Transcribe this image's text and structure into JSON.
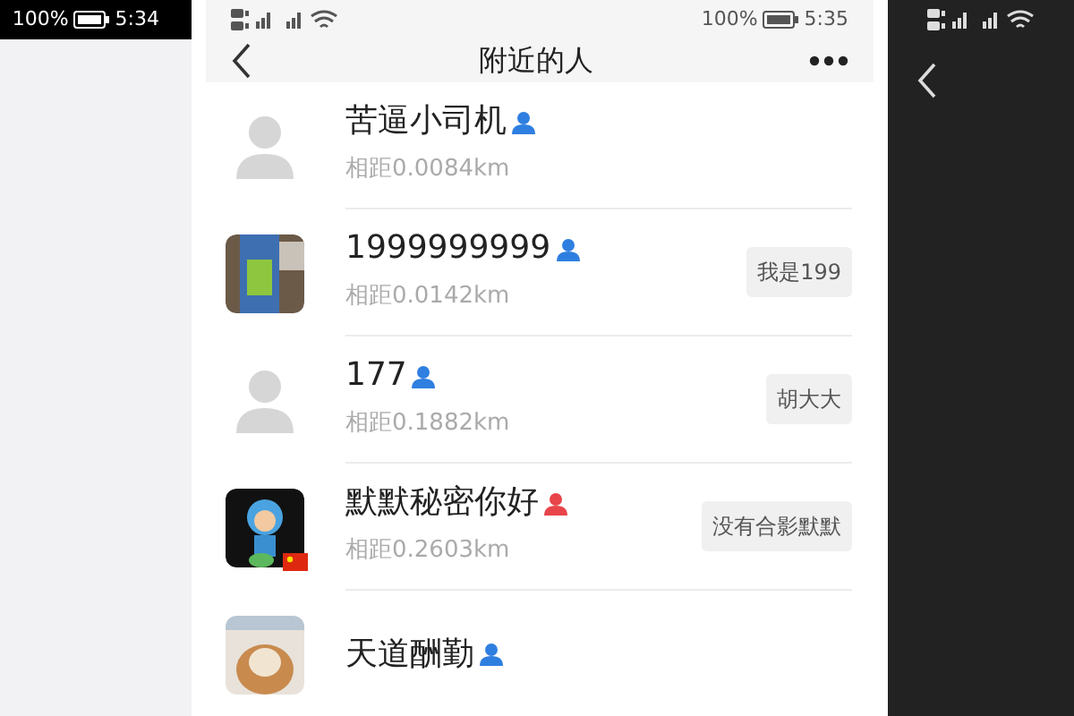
{
  "left_screen": {
    "status_bar": {
      "battery": "100%",
      "time": "5:34"
    }
  },
  "main_screen": {
    "status_bar": {
      "battery": "100%",
      "time": "5:35"
    },
    "title": "附近的人",
    "people": [
      {
        "name": "苦逼小司机",
        "color": "#2f7fe0",
        "distance": "相距0.0084km",
        "kind": "default"
      },
      {
        "name": "1999999999",
        "color": "#2f7fe0",
        "distance": "相距0.0142km",
        "kind": "picture",
        "tag": "我是199"
      },
      {
        "name": "177",
        "color": "#2f7fe0",
        "distance": "相距0.1882km",
        "kind": "default",
        "tag": "胡大大"
      },
      {
        "name": "默默秘密你好",
        "color": "#e8454a",
        "distance": "相距0.2603km",
        "kind": "picture",
        "flag_badge": true,
        "tag": "没有合影默默"
      },
      {
        "name": "天道酬勤",
        "color": "#2f7fe0",
        "kind": "picture"
      }
    ]
  }
}
